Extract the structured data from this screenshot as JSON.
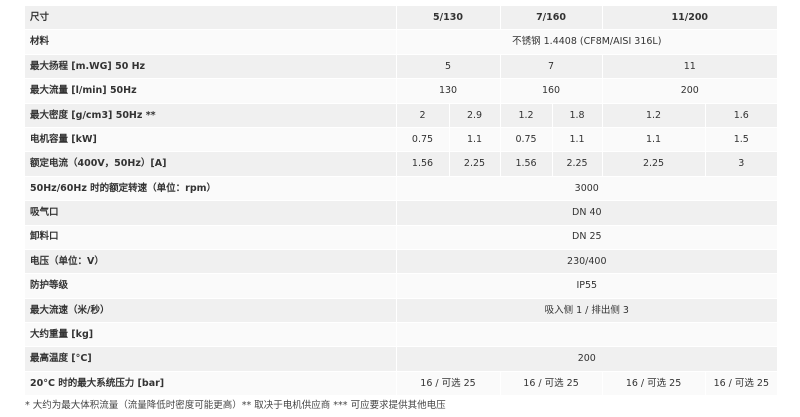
{
  "table": {
    "header": {
      "label": "尺寸",
      "columns": [
        "5/130",
        "7/160",
        "11/200"
      ]
    },
    "rows": [
      {
        "label": "材料",
        "cells": [
          {
            "text": "不锈钢 1.4408 (CF8M/AISI 316L)",
            "span": 6
          }
        ]
      },
      {
        "label": "最大扬程 [m.WG] 50 Hz",
        "cells": [
          {
            "text": "5",
            "span": 2
          },
          {
            "text": "7",
            "span": 2
          },
          {
            "text": "11",
            "span": 2
          }
        ]
      },
      {
        "label": "最大流量 [l/min] 50Hz",
        "cells": [
          {
            "text": "130",
            "span": 2
          },
          {
            "text": "160",
            "span": 2
          },
          {
            "text": "200",
            "span": 2
          }
        ]
      },
      {
        "label": "最大密度 [g/cm3] 50Hz **",
        "cells": [
          {
            "text": "2",
            "span": 1
          },
          {
            "text": "2.9",
            "span": 1
          },
          {
            "text": "1.2",
            "span": 1
          },
          {
            "text": "1.8",
            "span": 1
          },
          {
            "text": "1.2",
            "span": 1
          },
          {
            "text": "1.6",
            "span": 1
          }
        ]
      },
      {
        "label": "电机容量 [kW]",
        "cells": [
          {
            "text": "0.75",
            "span": 1
          },
          {
            "text": "1.1",
            "span": 1
          },
          {
            "text": "0.75",
            "span": 1
          },
          {
            "text": "1.1",
            "span": 1
          },
          {
            "text": "1.1",
            "span": 1
          },
          {
            "text": "1.5",
            "span": 1
          }
        ]
      },
      {
        "label": "额定电流（400V，50Hz）[A]",
        "cells": [
          {
            "text": "1.56",
            "span": 1
          },
          {
            "text": "2.25",
            "span": 1
          },
          {
            "text": "1.56",
            "span": 1
          },
          {
            "text": "2.25",
            "span": 1
          },
          {
            "text": "2.25",
            "span": 1
          },
          {
            "text": "3",
            "span": 1
          }
        ]
      },
      {
        "label": "50Hz/60Hz 时的额定转速（单位：rpm）",
        "cells": [
          {
            "text": "3000",
            "span": 6
          }
        ]
      },
      {
        "label": "吸气口",
        "cells": [
          {
            "text": "DN 40",
            "span": 6
          }
        ]
      },
      {
        "label": "卸料口",
        "cells": [
          {
            "text": "DN 25",
            "span": 6
          }
        ]
      },
      {
        "label": "电压（单位：V）",
        "cells": [
          {
            "text": "230/400",
            "span": 6
          }
        ]
      },
      {
        "label": "防护等级",
        "cells": [
          {
            "text": "IP55",
            "span": 6
          }
        ]
      },
      {
        "label": "最大流速（米/秒）",
        "cells": [
          {
            "text": "吸入侧 1 / 排出侧 3",
            "span": 6
          }
        ]
      },
      {
        "label": "大约重量 [kg]",
        "cells": [
          {
            "text": "",
            "span": 6
          }
        ]
      },
      {
        "label": "最高温度 [°C]",
        "cells": [
          {
            "text": "200",
            "span": 6
          }
        ]
      },
      {
        "label": "20°C 时的最大系统压力 [bar]",
        "cells": [
          {
            "text": "16 / 可选 25",
            "span": 2
          },
          {
            "text": "16 / 可选 25",
            "span": 2
          },
          {
            "text": "16 / 可选 25",
            "span": 1
          },
          {
            "text": "16 / 可选 25",
            "span": 1
          }
        ]
      }
    ]
  },
  "footnote": "* 大约为最大体积流量（流量降低时密度可能更高）** 取决于电机供应商 *** 可应要求提供其他电压"
}
